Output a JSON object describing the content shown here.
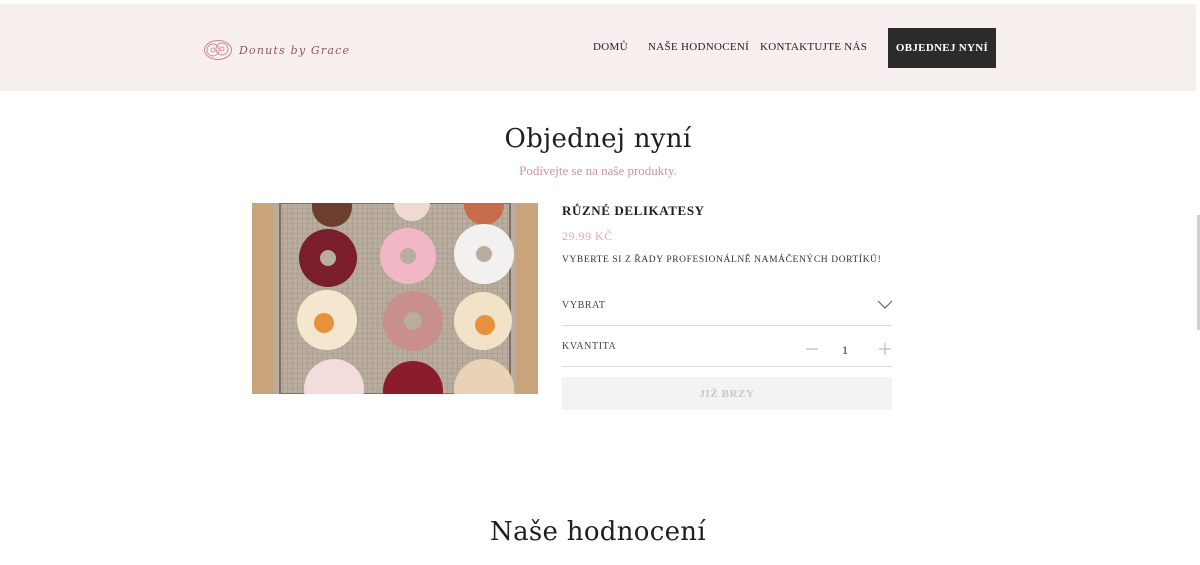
{
  "brand": {
    "name": "Donuts by Grace"
  },
  "nav": {
    "home": "DOMŮ",
    "reviews": "NAŠE HODNOCENÍ",
    "contact": "KONTAKTUJTE NÁS",
    "cta": "OBJEDNEJ NYNÍ"
  },
  "order": {
    "title": "Objednej nyní",
    "subtitle": "Podívejte se na naše produkty."
  },
  "product": {
    "name": "RŮZNÉ DELIKATESY",
    "price": "29.99 KČ",
    "description": "VYBERTE SI Z ŘADY PROFESIONÁLNĚ NAMÁČENÝCH DORTÍKŮ!",
    "select_label": "VYBRAT",
    "quantity_label": "KVANTITA",
    "quantity": "1",
    "button_label": "JIŽ BRZY"
  },
  "reviews": {
    "title": "Naše hodnocení"
  },
  "colors": {
    "header_bg": "#f7eeee",
    "accent_pink": "#d48fa9",
    "cta_bg": "#2b2b2b"
  }
}
